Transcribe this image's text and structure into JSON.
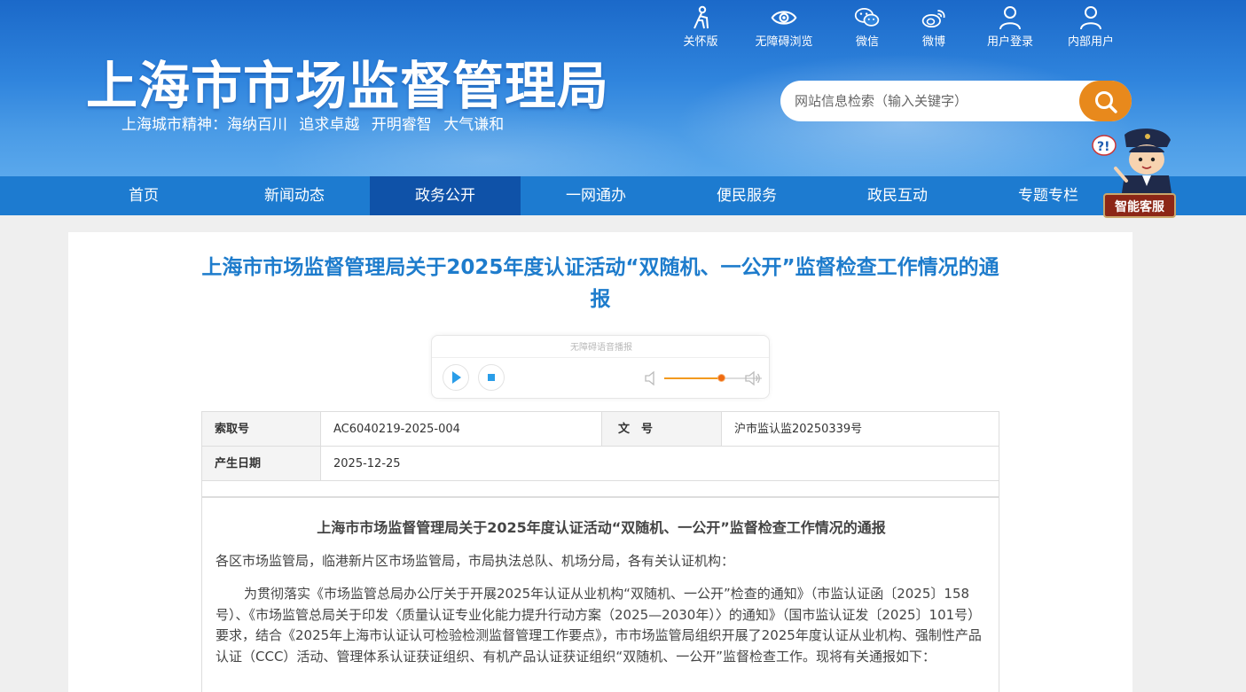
{
  "header": {
    "site_title": "上海市市场监督管理局",
    "slogan": "上海城市精神：海纳百川   追求卓越   开明睿智   大气谦和"
  },
  "top_links": [
    {
      "label": "关怀版",
      "icon": "elderly-care-icon"
    },
    {
      "label": "无障碍浏览",
      "icon": "eye-icon"
    },
    {
      "label": "微信",
      "icon": "wechat-icon"
    },
    {
      "label": "微博",
      "icon": "weibo-icon"
    },
    {
      "label": "用户登录",
      "icon": "user-icon"
    },
    {
      "label": "内部用户",
      "icon": "user-icon"
    }
  ],
  "search": {
    "placeholder": "网站信息检索（输入关键字）"
  },
  "nav": {
    "items": [
      "首页",
      "新闻动态",
      "政务公开",
      "一网通办",
      "便民服务",
      "政民互动",
      "专题专栏"
    ],
    "active": "政务公开"
  },
  "assistant": {
    "label": "智能客服"
  },
  "article": {
    "title": "上海市市场监督管理局关于2025年度认证活动“双随机、一公开”监督检查工作情况的通报",
    "player_title": "无障碍语音播报",
    "volume_level": 0.58,
    "meta": {
      "index_label": "索取号",
      "index_value": "AC6040219-2025-004",
      "doc_label": "文　号",
      "doc_value": "沪市监认监20250339号",
      "date_label": "产生日期",
      "date_value": "2025-12-25"
    },
    "body_title": "上海市市场监督管理局关于2025年度认证活动“双随机、一公开”监督检查工作情况的通报",
    "salutation": "各区市场监管局，临港新片区市场监管局，市局执法总队、机场分局，各有关认证机构：",
    "paragraph1": "为贯彻落实《市场监管总局办公厅关于开展2025年认证从业机构“双随机、一公开”检查的通知》（市监认证函〔2025〕158号）、《市场监管总局关于印发〈质量认证专业化能力提升行动方案（2025—2030年）〉的通知》（国市监认证发〔2025〕101号）要求，结合《2025年上海市认证认可检验检测监督管理工作要点》，市市场监管局组织开展了2025年度认证从业机构、强制性产品认证（CCC）活动、管理体系认证获证组织、有机产品认证获证组织“双随机、一公开”监督检查工作。现将有关通报如下："
  },
  "colors": {
    "header_blue": "#1b69c9",
    "nav_blue": "#1d7bd0",
    "nav_active": "#0f52a8",
    "title_blue": "#1e7ccc",
    "search_orange": "#e8891c"
  }
}
